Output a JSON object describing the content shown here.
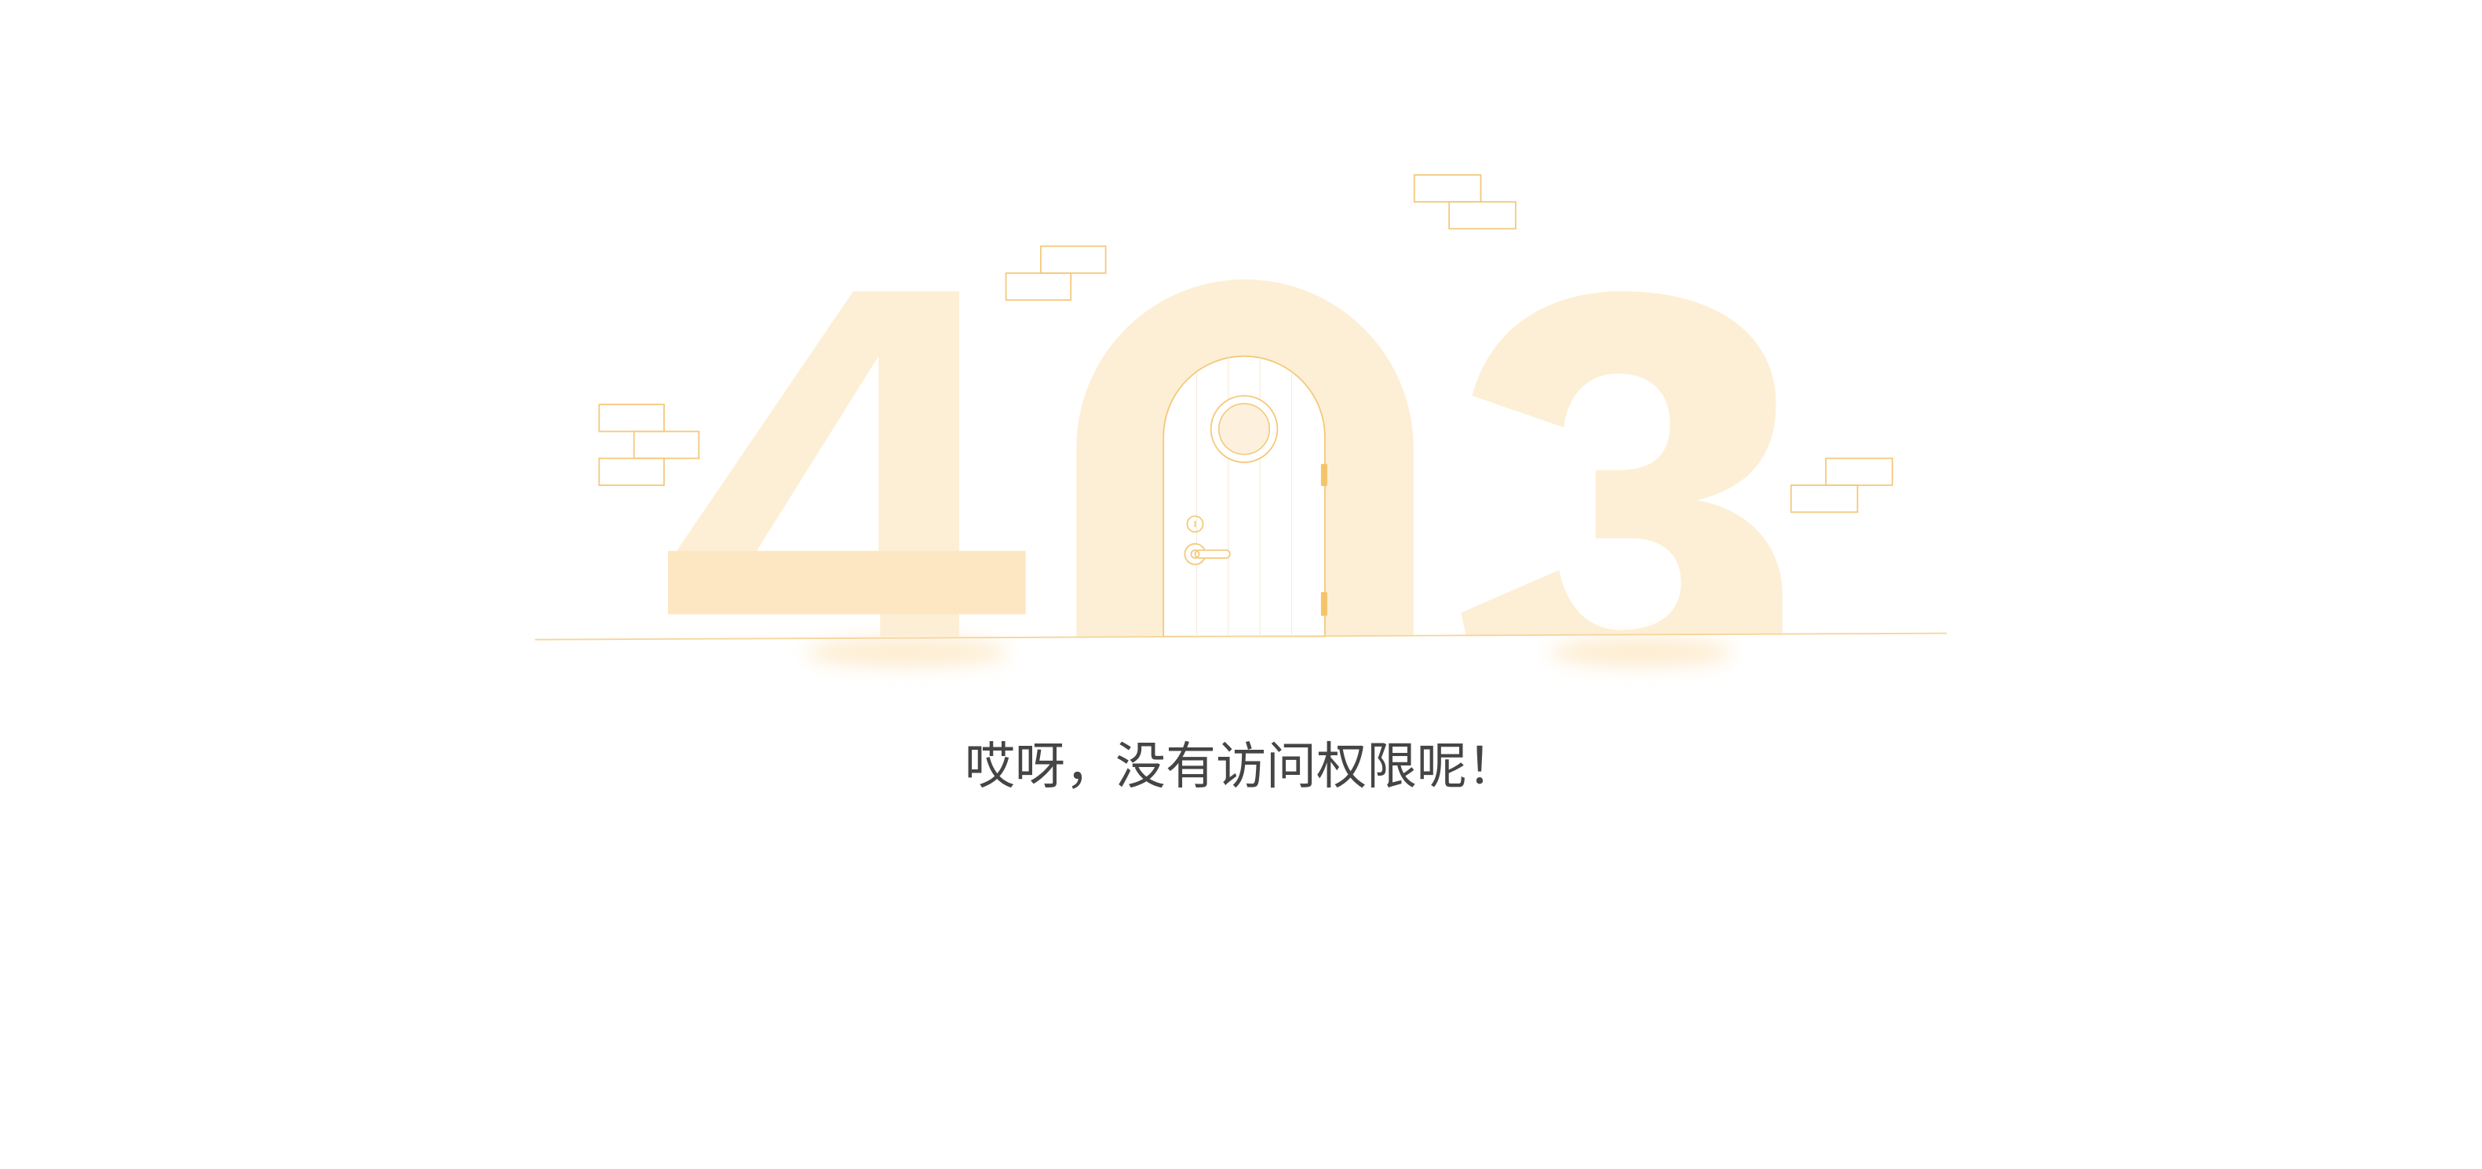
{
  "illustration": {
    "code": "403"
  },
  "message": "哎呀，没有访问权限呢！",
  "colors": {
    "background": "#ffffff",
    "digit_fill": "#fdefd5",
    "crossbar_fill": "#fde7c2",
    "accent_stroke": "#f4c97c",
    "door_fill": "#ffffff",
    "window_fill": "#fdf1de",
    "hinge_fill": "#f3c46c",
    "ground_line": "#f5d59a",
    "shadow": "#fde6c0",
    "message_text": "#454545"
  }
}
